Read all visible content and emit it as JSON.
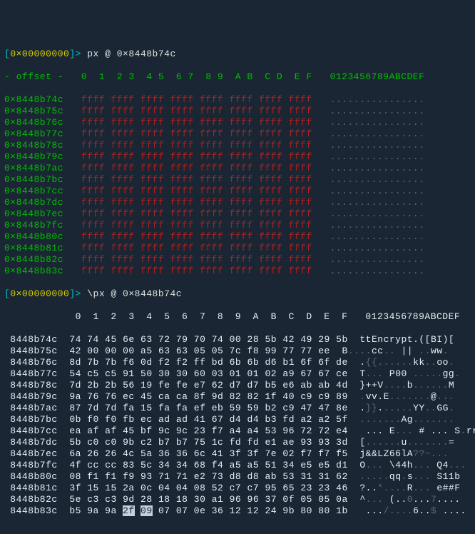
{
  "prompt1": {
    "open": "[",
    "hex": "0×00000000",
    "close": "]> ",
    "cmd": "px @ 0×8448b74c"
  },
  "header1": {
    "pre": "- offset -   ",
    "cols": "0  1  2 3  4 5  6 7  8 9  A B  C D  E F   ",
    "asciiCols": "0123456789ABCDEF"
  },
  "ffRows": [
    {
      "addr": "0×8448b74c"
    },
    {
      "addr": "0×8448b75c"
    },
    {
      "addr": "0×8448b76c"
    },
    {
      "addr": "0×8448b77c"
    },
    {
      "addr": "0×8448b78c"
    },
    {
      "addr": "0×8448b79c"
    },
    {
      "addr": "0×8448b7ac"
    },
    {
      "addr": "0×8448b7bc"
    },
    {
      "addr": "0×8448b7cc"
    },
    {
      "addr": "0×8448b7dc"
    },
    {
      "addr": "0×8448b7ec"
    },
    {
      "addr": "0×8448b7fc"
    },
    {
      "addr": "0×8448b80c"
    },
    {
      "addr": "0×8448b81c"
    },
    {
      "addr": "0×8448b82c"
    },
    {
      "addr": "0×8448b83c"
    }
  ],
  "ffHex": "ffff ffff ffff ffff ffff ffff ffff ffff",
  "ffAscii": "................",
  "prompt2": {
    "open": "[",
    "hex": "0×00000000",
    "close": "]> ",
    "cmd": "\\px @ 0×8448b74c"
  },
  "header2": {
    "pre": "            ",
    "cols": "0  1  2  3  4  5  6  7  8  9  A  B  C  D  E  F   ",
    "asciiCols": "0123456789ABCDEF"
  },
  "rows": [
    {
      "addr": "8448b74c",
      "hex": "74 74 45 6e 63 72 79 70 74 00 28 5b 42 49 29 5b",
      "ascii": "ttEncrypt.([BI)["
    },
    {
      "addr": "8448b75c",
      "hex": "42 00 00 00 a5 63 63 05 05 7c f8 99 77 77 ee",
      "asciiSeg": [
        [
          "wh",
          "  B"
        ],
        [
          "dim",
          "...."
        ],
        [
          "wh",
          "cc"
        ],
        [
          "dim",
          ".."
        ],
        [
          "wh",
          " || "
        ],
        [
          "dim",
          ".."
        ],
        [
          "wh",
          "ww"
        ],
        [
          "dim",
          "."
        ]
      ]
    },
    {
      "addr": "8448b76c",
      "hex": "8d 7b 7b f6 0d f2 f2 ff bd 6b 6b d6 b1 6f 6f de",
      "asciiSeg": [
        [
          "wh",
          "  ."
        ],
        [
          "dim",
          "{{......"
        ],
        [
          "wh",
          "kk"
        ],
        [
          "dim",
          ".."
        ],
        [
          "wh",
          "oo"
        ],
        [
          "dim",
          "."
        ]
      ]
    },
    {
      "addr": "8448b77c",
      "hex": "54 c5 c5 91 50 30 30 60 03 01 01 02 a9 67 67 ce",
      "asciiSeg": [
        [
          "wh",
          "  T"
        ],
        [
          "dim",
          "... "
        ],
        [
          "wh",
          "P00"
        ],
        [
          "dim",
          " ....."
        ],
        [
          "wh",
          "gg"
        ],
        [
          "dim",
          "."
        ]
      ]
    },
    {
      "addr": "8448b78c",
      "hex": "7d 2b 2b 56 19 fe fe e7 62 d7 d7 b5 e6 ab ab 4d",
      "asciiSeg": [
        [
          "wh",
          "  }++V"
        ],
        [
          "dim",
          "...."
        ],
        [
          "wh",
          "b"
        ],
        [
          "dim",
          "......"
        ],
        [
          "wh",
          "M"
        ]
      ]
    },
    {
      "addr": "8448b79c",
      "hex": "9a 76 76 ec 45 ca ca 8f 9d 82 82 1f 40 c9 c9 89",
      "asciiSeg": [
        [
          "wh",
          "  "
        ],
        [
          "dim",
          "."
        ],
        [
          "wh",
          "vv.E"
        ],
        [
          "dim",
          "......."
        ],
        [
          "wh",
          "@"
        ],
        [
          "dim",
          "..."
        ]
      ]
    },
    {
      "addr": "8448b7ac",
      "hex": "87 7d 7d fa 15 fa fa ef eb 59 59 b2 c9 47 47 8e",
      "asciiSeg": [
        [
          "wh",
          "  ."
        ],
        [
          "dim",
          "}}"
        ],
        [
          "wh",
          "."
        ],
        [
          "dim",
          "....."
        ],
        [
          "wh",
          "YY"
        ],
        [
          "dim",
          ".."
        ],
        [
          "wh",
          "GG"
        ],
        [
          "dim",
          "."
        ]
      ]
    },
    {
      "addr": "8448b7bc",
      "hex": "0b f0 f0 fb ec ad ad 41 67 d4 d4 b3 fd a2 a2 5f",
      "asciiSeg": [
        [
          "wh",
          "  "
        ],
        [
          "dim",
          "......."
        ],
        [
          "wh",
          "Ag"
        ],
        [
          "dim",
          "......."
        ]
      ]
    },
    {
      "addr": "8448b7cc",
      "hex": "ea af af 45 bf 9c 9c 23 f7 a4 a4 53 96 72 72 e4",
      "asciiSeg": [
        [
          "wh",
          "   ... E"
        ],
        [
          "dim",
          "..."
        ],
        [
          "wh",
          " # ..."
        ],
        [
          "dim",
          " "
        ],
        [
          "wh",
          "S"
        ],
        [
          "dim",
          "."
        ],
        [
          "wh",
          "rr"
        ],
        [
          "dim",
          "."
        ]
      ]
    },
    {
      "addr": "8448b7dc",
      "hex": "5b c0 c0 9b c2 b7 b7 75 1c fd fd e1 ae 93 93 3d",
      "asciiSeg": [
        [
          "wh",
          "  ["
        ],
        [
          "dim",
          "......"
        ],
        [
          "wh",
          "u"
        ],
        [
          "dim",
          "......."
        ],
        [
          "wh",
          "="
        ]
      ]
    },
    {
      "addr": "8448b7ec",
      "hex": "6a 26 26 4c 5a 36 36 6c 41 3f 3f 7e 02 f7 f7 f5",
      "asciiSeg": [
        [
          "wh",
          "  j&&LZ66lA"
        ],
        [
          "dim",
          "??~..."
        ]
      ]
    },
    {
      "addr": "8448b7fc",
      "hex": "4f cc cc 83 5c 34 34 68 f4 a5 a5 51 34 e5 e5 d1",
      "asciiSeg": [
        [
          "wh",
          "  O"
        ],
        [
          "dim",
          "..."
        ],
        [
          "wh",
          " \\44h"
        ],
        [
          "dim",
          "..."
        ],
        [
          "wh",
          " Q4"
        ],
        [
          "dim",
          "..."
        ]
      ]
    },
    {
      "addr": "8448b80c",
      "hex": "08 f1 f1 f9 93 71 71 e2 73 d8 d8 ab 53 31 31 62",
      "asciiSeg": [
        [
          "wh",
          "  "
        ],
        [
          "dim",
          "....."
        ],
        [
          "wh",
          "qq"
        ],
        [
          "dim",
          "."
        ],
        [
          "wh",
          "s"
        ],
        [
          "dim",
          "..."
        ],
        [
          "wh",
          " S11b"
        ]
      ]
    },
    {
      "addr": "8448b81c",
      "hex": "3f 15 15 2a 0c 04 04 08 52 c7 c7 95 65 23 23 46",
      "asciiSeg": [
        [
          "wh",
          "  ?.."
        ],
        [
          "dim",
          "*...."
        ],
        [
          "wh",
          "R"
        ],
        [
          "dim",
          "..."
        ],
        [
          "wh",
          " e##F"
        ]
      ]
    },
    {
      "addr": "8448b82c",
      "hex": "5e c3 c3 9d 28 18 18 30 a1 96 96 37 0f 05 05 0a",
      "asciiSeg": [
        [
          "wh",
          "  ^"
        ],
        [
          "dim",
          "..."
        ],
        [
          "wh",
          " (.."
        ],
        [
          "dim",
          "0"
        ],
        [
          "wh",
          "..."
        ],
        [
          "dim",
          "7"
        ],
        [
          "wh",
          "...."
        ]
      ]
    },
    {
      "addr": "8448b83c",
      "hex": "b5 9a 9a 2f 09 07 07 0e 36 12 12 24 9b 80 80 1b",
      "asciiSeg": [
        [
          "wh",
          "   ..."
        ],
        [
          "dim",
          "/...."
        ],
        [
          "wh",
          "6.."
        ],
        [
          "dim",
          "$"
        ],
        [
          "wh",
          " ...."
        ]
      ],
      "sel": [
        3,
        5
      ]
    }
  ]
}
